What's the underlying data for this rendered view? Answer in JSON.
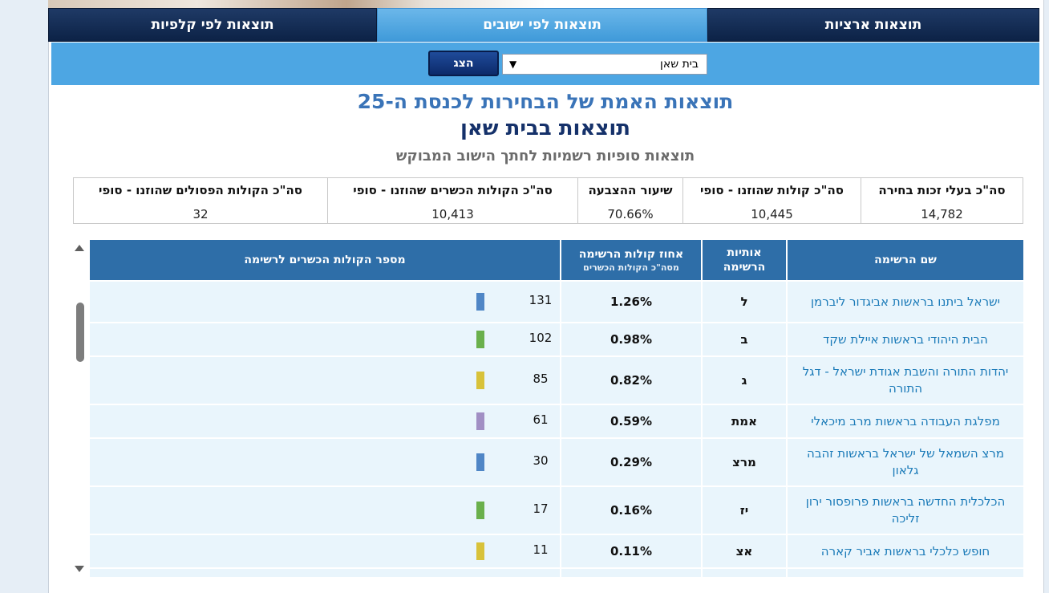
{
  "tabs": {
    "national": "תוצאות ארציות",
    "by_settlement": "תוצאות לפי ישובים",
    "by_ballot": "תוצאות לפי קלפיות"
  },
  "filter": {
    "selected_settlement": "בית שאן",
    "show_button": "הצג"
  },
  "headings": {
    "title": "תוצאות האמת של הבחירות לכנסת ה-25",
    "subtitle": "תוצאות בבית שאן",
    "note": "תוצאות סופיות רשמיות לחתך הישוב המבוקש"
  },
  "summary": {
    "eligible_label": "סה\"כ בעלי זכות בחירה",
    "eligible_value": "14,782",
    "votes_cast_label": "סה\"כ קולות שהוזנו - סופי",
    "votes_cast_value": "10,445",
    "turnout_label": "שיעור ההצבעה",
    "turnout_value": "70.66%",
    "valid_label": "סה\"כ הקולות הכשרים שהוזנו - סופי",
    "valid_value": "10,413",
    "invalid_label": "סה\"כ הקולות הפסולים שהוזנו - סופי",
    "invalid_value": "32"
  },
  "table": {
    "headers": {
      "name": "שם הרשימה",
      "letters": "אותיות הרשימה",
      "percent": "אחוז קולות הרשימה",
      "percent_sub": "מסה\"כ הקולות הכשרים",
      "votes": "מספר הקולות הכשרים לרשימה"
    },
    "rows": [
      {
        "name": "ישראל ביתנו בראשות אביגדור ליברמן",
        "letters": "ל",
        "percent": "1.26%",
        "votes": "131",
        "bar_color": "#4f86c6"
      },
      {
        "name": "הבית היהודי בראשות איילת שקד",
        "letters": "ב",
        "percent": "0.98%",
        "votes": "102",
        "bar_color": "#6ab04c"
      },
      {
        "name": "יהדות התורה והשבת אגודת ישראל - דגל התורה",
        "letters": "ג",
        "percent": "0.82%",
        "votes": "85",
        "bar_color": "#d8c23a"
      },
      {
        "name": "מפלגת העבודה בראשות מרב מיכאלי",
        "letters": "אמת",
        "percent": "0.59%",
        "votes": "61",
        "bar_color": "#a18fc4"
      },
      {
        "name": "מרצ השמאל של ישראל בראשות זהבה גלאון",
        "letters": "מרצ",
        "percent": "0.29%",
        "votes": "30",
        "bar_color": "#4f86c6"
      },
      {
        "name": "הכלכלית החדשה בראשות פרופסור ירון זליכה",
        "letters": "יז",
        "percent": "0.16%",
        "votes": "17",
        "bar_color": "#6ab04c"
      },
      {
        "name": "חופש כלכלי בראשות אביר קארה",
        "letters": "אצ",
        "percent": "0.11%",
        "votes": "11",
        "bar_color": "#d8c23a"
      }
    ]
  }
}
